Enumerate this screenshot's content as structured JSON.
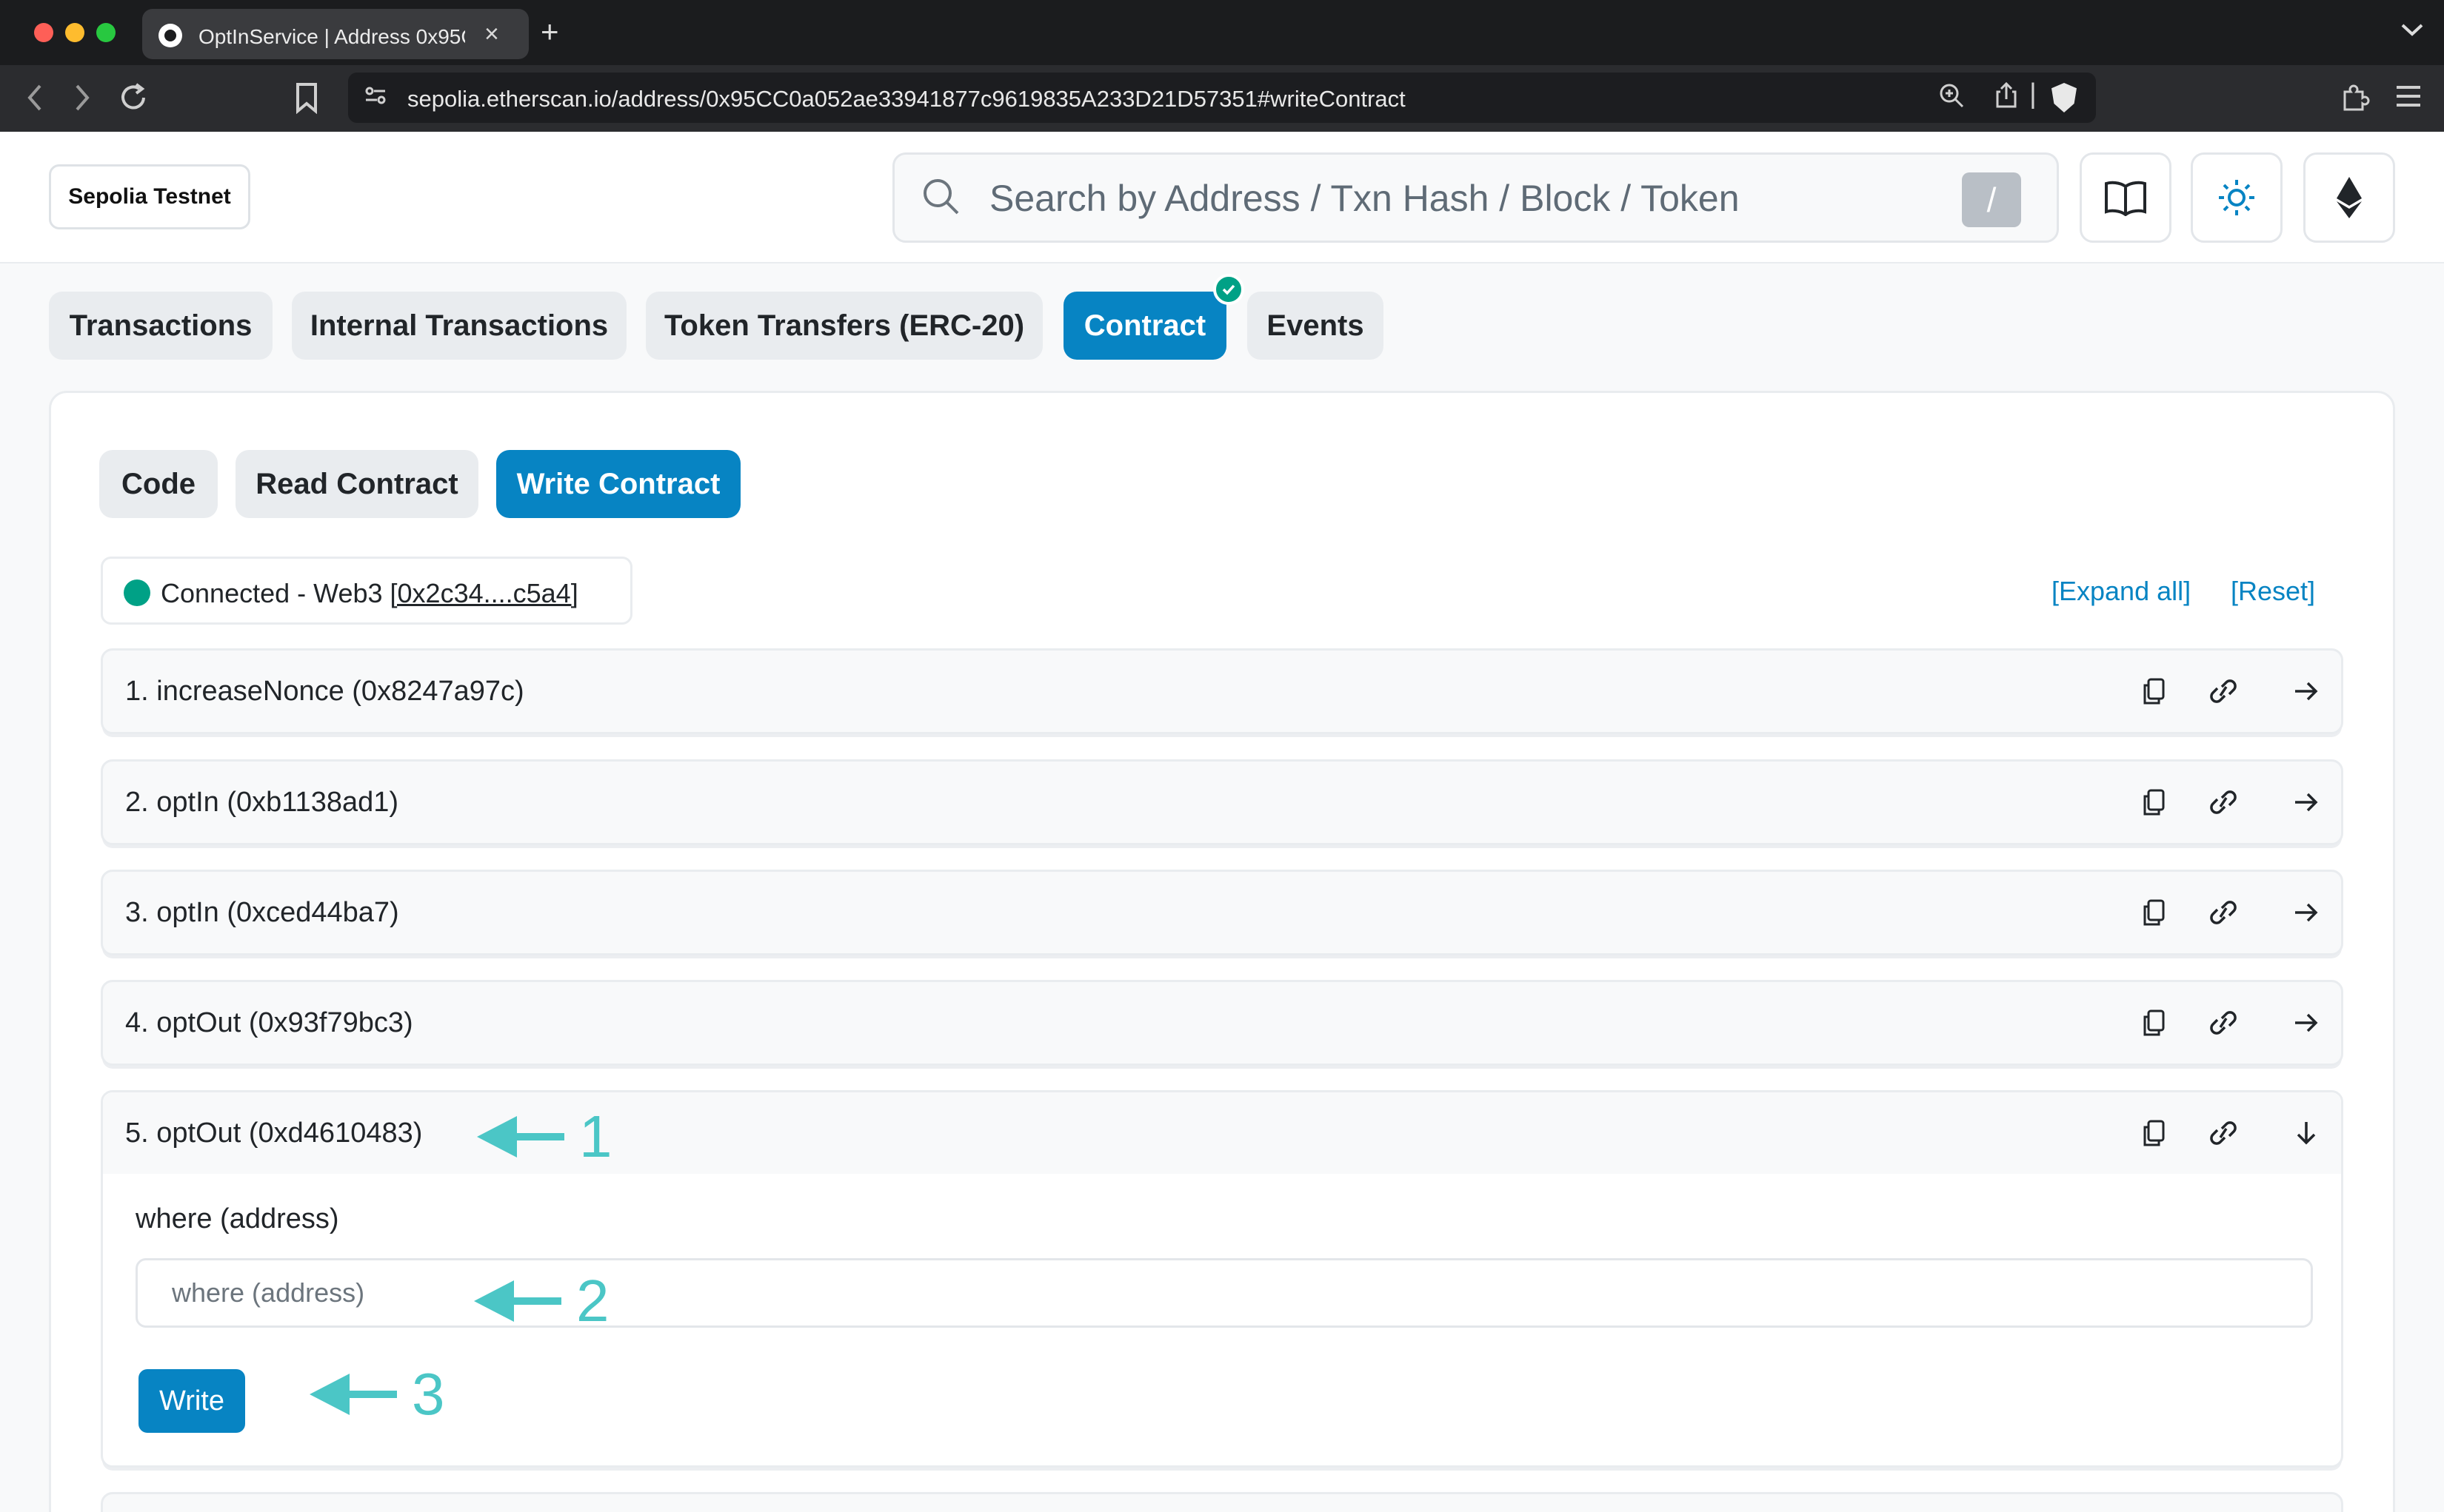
{
  "browser": {
    "tab_title": "OptInService | Address 0x95C",
    "tab_close": "×",
    "new_tab": "+",
    "tab_menu": "⌄",
    "url": "sepolia.etherscan.io/address/0x95CC0a052ae33941877c9619835A233D21D57351#writeContract"
  },
  "header": {
    "network": "Sepolia Testnet",
    "search_placeholder": "Search by Address / Txn Hash / Block / Token",
    "search_shortcut": "/"
  },
  "tabs": [
    {
      "label": "Transactions",
      "active": false
    },
    {
      "label": "Internal Transactions",
      "active": false
    },
    {
      "label": "Token Transfers (ERC-20)",
      "active": false
    },
    {
      "label": "Contract",
      "active": true,
      "verified": true
    },
    {
      "label": "Events",
      "active": false
    }
  ],
  "subtabs": [
    {
      "label": "Code",
      "active": false
    },
    {
      "label": "Read Contract",
      "active": false
    },
    {
      "label": "Write Contract",
      "active": true
    }
  ],
  "connection": {
    "status": "Connected - Web3",
    "address": "[0x2c34....c5a4]"
  },
  "links": {
    "expand_all": "[Expand all]",
    "reset": "[Reset]"
  },
  "functions": [
    {
      "label": "1. increaseNonce (0x8247a97c)",
      "expanded": false
    },
    {
      "label": "2. optIn (0xb1138ad1)",
      "expanded": false
    },
    {
      "label": "3. optIn (0xced44ba7)",
      "expanded": false
    },
    {
      "label": "4. optOut (0x93f79bc3)",
      "expanded": false
    },
    {
      "label": "5. optOut (0xd4610483)",
      "expanded": true
    }
  ],
  "expanded_function": {
    "param_label": "where (address)",
    "param_placeholder": "where (address)",
    "param_value": "",
    "write_label": "Write"
  },
  "annotations": [
    "1",
    "2",
    "3"
  ],
  "colors": {
    "accent": "#0784c3",
    "success": "#00a186",
    "annotation": "#4bc6c6",
    "tab_bg": "#e9ecef"
  }
}
